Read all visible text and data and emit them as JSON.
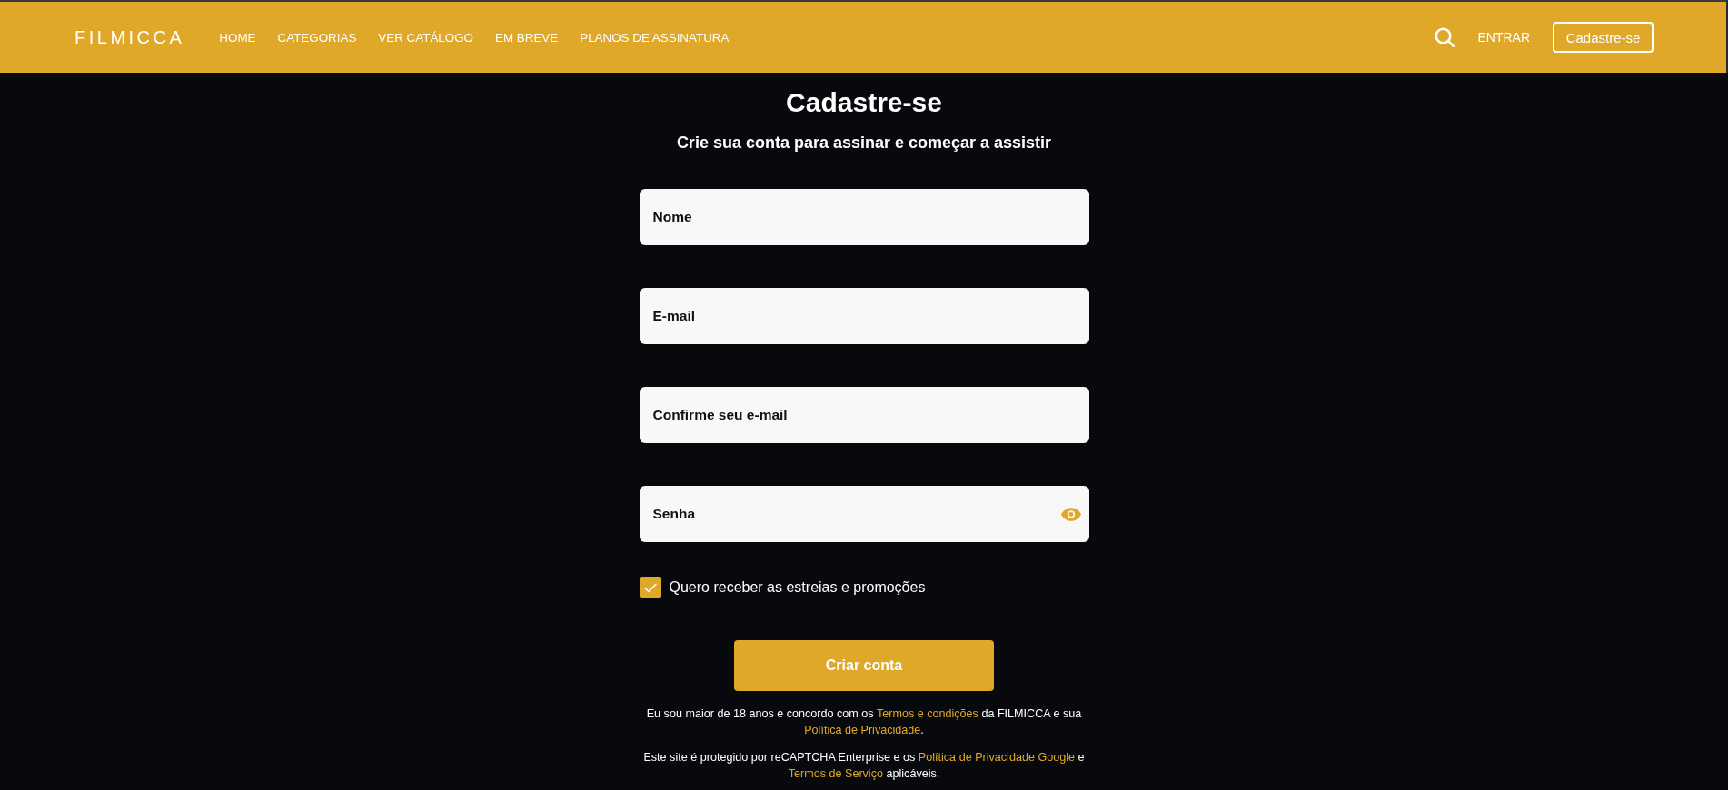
{
  "header": {
    "logo": "FILMICCA",
    "nav": [
      {
        "label": "HOME"
      },
      {
        "label": "CATEGORIAS"
      },
      {
        "label": "VER CATÁLOGO"
      },
      {
        "label": "EM BREVE"
      },
      {
        "label": "PLANOS DE ASSINATURA"
      }
    ],
    "login": "ENTRAR",
    "signup_button": "Cadastre-se"
  },
  "form": {
    "title": "Cadastre-se",
    "subtitle": "Crie sua conta para assinar e começar a assistir",
    "fields": [
      {
        "kind": "text",
        "placeholder": "Nome"
      },
      {
        "kind": "text",
        "placeholder": "E-mail"
      },
      {
        "kind": "text",
        "placeholder": "Confirme seu e-mail"
      },
      {
        "kind": "password",
        "placeholder": "Senha"
      }
    ],
    "newsletter": {
      "label": "Quero receber as estreias e promoções",
      "checked": true
    },
    "submit": "Criar conta",
    "legal": [
      {
        "segments": [
          {
            "kind": "text",
            "text": "Eu sou maior de 18 anos e concordo com os "
          },
          {
            "kind": "link",
            "text": "Termos e condições"
          },
          {
            "kind": "text",
            "text": " da FILMICCA e sua "
          },
          {
            "kind": "link",
            "text": "Política de Privacidade"
          },
          {
            "kind": "text",
            "text": "."
          }
        ]
      },
      {
        "segments": [
          {
            "kind": "text",
            "text": "Este site é protegido por reCAPTCHA Enterprise e os "
          },
          {
            "kind": "link",
            "text": "Política de Privacidade Google"
          },
          {
            "kind": "text",
            "text": " e "
          },
          {
            "kind": "link",
            "text": "Termos de Serviço"
          },
          {
            "kind": "text",
            "text": " aplicáveis."
          }
        ]
      }
    ]
  }
}
